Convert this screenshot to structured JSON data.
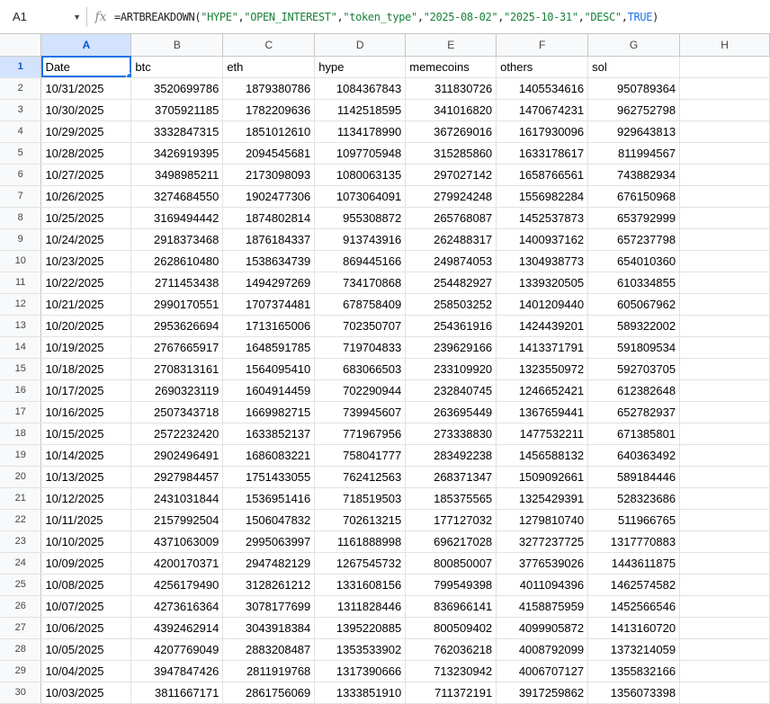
{
  "name_box": "A1",
  "formula_bar": {
    "fx": "fx",
    "formula_parts": [
      {
        "t": "plain",
        "v": "=ARTBREAKDOWN("
      },
      {
        "t": "str",
        "v": "\"HYPE\""
      },
      {
        "t": "plain",
        "v": ","
      },
      {
        "t": "str",
        "v": "\"OPEN_INTEREST\""
      },
      {
        "t": "plain",
        "v": ","
      },
      {
        "t": "str",
        "v": "\"token_type\""
      },
      {
        "t": "plain",
        "v": ","
      },
      {
        "t": "str",
        "v": "\"2025-08-02\""
      },
      {
        "t": "plain",
        "v": ","
      },
      {
        "t": "str",
        "v": "\"2025-10-31\""
      },
      {
        "t": "plain",
        "v": ","
      },
      {
        "t": "str",
        "v": "\"DESC\""
      },
      {
        "t": "plain",
        "v": ","
      },
      {
        "t": "bool",
        "v": "TRUE"
      },
      {
        "t": "plain",
        "v": ")"
      }
    ]
  },
  "columns": [
    "A",
    "B",
    "C",
    "D",
    "E",
    "F",
    "G",
    "H"
  ],
  "selected_column": "A",
  "selected_row": 1,
  "header_row": [
    "Date",
    "btc",
    "eth",
    "hype",
    "memecoins",
    "others",
    "sol",
    ""
  ],
  "rows": [
    [
      "10/31/2025",
      "3520699786",
      "1879380786",
      "1084367843",
      "311830726",
      "1405534616",
      "950789364",
      ""
    ],
    [
      "10/30/2025",
      "3705921185",
      "1782209636",
      "1142518595",
      "341016820",
      "1470674231",
      "962752798",
      ""
    ],
    [
      "10/29/2025",
      "3332847315",
      "1851012610",
      "1134178990",
      "367269016",
      "1617930096",
      "929643813",
      ""
    ],
    [
      "10/28/2025",
      "3426919395",
      "2094545681",
      "1097705948",
      "315285860",
      "1633178617",
      "811994567",
      ""
    ],
    [
      "10/27/2025",
      "3498985211",
      "2173098093",
      "1080063135",
      "297027142",
      "1658766561",
      "743882934",
      ""
    ],
    [
      "10/26/2025",
      "3274684550",
      "1902477306",
      "1073064091",
      "279924248",
      "1556982284",
      "676150968",
      ""
    ],
    [
      "10/25/2025",
      "3169494442",
      "1874802814",
      "955308872",
      "265768087",
      "1452537873",
      "653792999",
      ""
    ],
    [
      "10/24/2025",
      "2918373468",
      "1876184337",
      "913743916",
      "262488317",
      "1400937162",
      "657237798",
      ""
    ],
    [
      "10/23/2025",
      "2628610480",
      "1538634739",
      "869445166",
      "249874053",
      "1304938773",
      "654010360",
      ""
    ],
    [
      "10/22/2025",
      "2711453438",
      "1494297269",
      "734170868",
      "254482927",
      "1339320505",
      "610334855",
      ""
    ],
    [
      "10/21/2025",
      "2990170551",
      "1707374481",
      "678758409",
      "258503252",
      "1401209440",
      "605067962",
      ""
    ],
    [
      "10/20/2025",
      "2953626694",
      "1713165006",
      "702350707",
      "254361916",
      "1424439201",
      "589322002",
      ""
    ],
    [
      "10/19/2025",
      "2767665917",
      "1648591785",
      "719704833",
      "239629166",
      "1413371791",
      "591809534",
      ""
    ],
    [
      "10/18/2025",
      "2708313161",
      "1564095410",
      "683066503",
      "233109920",
      "1323550972",
      "592703705",
      ""
    ],
    [
      "10/17/2025",
      "2690323119",
      "1604914459",
      "702290944",
      "232840745",
      "1246652421",
      "612382648",
      ""
    ],
    [
      "10/16/2025",
      "2507343718",
      "1669982715",
      "739945607",
      "263695449",
      "1367659441",
      "652782937",
      ""
    ],
    [
      "10/15/2025",
      "2572232420",
      "1633852137",
      "771967956",
      "273338830",
      "1477532211",
      "671385801",
      ""
    ],
    [
      "10/14/2025",
      "2902496491",
      "1686083221",
      "758041777",
      "283492238",
      "1456588132",
      "640363492",
      ""
    ],
    [
      "10/13/2025",
      "2927984457",
      "1751433055",
      "762412563",
      "268371347",
      "1509092661",
      "589184446",
      ""
    ],
    [
      "10/12/2025",
      "2431031844",
      "1536951416",
      "718519503",
      "185375565",
      "1325429391",
      "528323686",
      ""
    ],
    [
      "10/11/2025",
      "2157992504",
      "1506047832",
      "702613215",
      "177127032",
      "1279810740",
      "511966765",
      ""
    ],
    [
      "10/10/2025",
      "4371063009",
      "2995063997",
      "1161888998",
      "696217028",
      "3277237725",
      "1317770883",
      ""
    ],
    [
      "10/09/2025",
      "4200170371",
      "2947482129",
      "1267545732",
      "800850007",
      "3776539026",
      "1443611875",
      ""
    ],
    [
      "10/08/2025",
      "4256179490",
      "3128261212",
      "1331608156",
      "799549398",
      "4011094396",
      "1462574582",
      ""
    ],
    [
      "10/07/2025",
      "4273616364",
      "3078177699",
      "1311828446",
      "836966141",
      "4158875959",
      "1452566546",
      ""
    ],
    [
      "10/06/2025",
      "4392462914",
      "3043918384",
      "1395220885",
      "800509402",
      "4099905872",
      "1413160720",
      ""
    ],
    [
      "10/05/2025",
      "4207769049",
      "2883208487",
      "1353533902",
      "762036218",
      "4008792099",
      "1373214059",
      ""
    ],
    [
      "10/04/2025",
      "3947847426",
      "2811919768",
      "1317390666",
      "713230942",
      "4006707127",
      "1355832166",
      ""
    ],
    [
      "10/03/2025",
      "3811667171",
      "2861756069",
      "1333851910",
      "711372191",
      "3917259862",
      "1356073398",
      ""
    ]
  ],
  "colors": {
    "accent": "#1a73e8",
    "header_bg": "#f8f9fa",
    "selected_header_bg": "#d3e3fd",
    "string_literal": "#188038"
  }
}
